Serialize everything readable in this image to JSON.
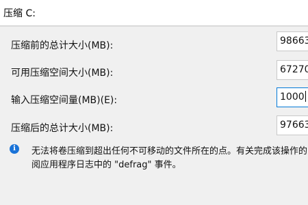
{
  "window": {
    "title": "压缩 C:"
  },
  "fields": [
    {
      "label": "压缩前的总计大小(MB):",
      "value": "98663"
    },
    {
      "label": "可用压缩空间大小(MB):",
      "value": "67270"
    },
    {
      "label": "输入压缩空间量(MB)(E):",
      "value": "1000"
    },
    {
      "label": "压缩后的总计大小(MB):",
      "value": "97663"
    }
  ],
  "info": {
    "icon": "info-icon",
    "line1": "无法将卷压缩到超出任何不可移动的文件所在的点。有关完成该操作的",
    "line2": "阅应用程序日志中的 \"defrag\" 事件。"
  },
  "colors": {
    "accent": "#0078d7",
    "info_icon": "#1a73d8",
    "panel_bg": "#f0f0f0"
  }
}
